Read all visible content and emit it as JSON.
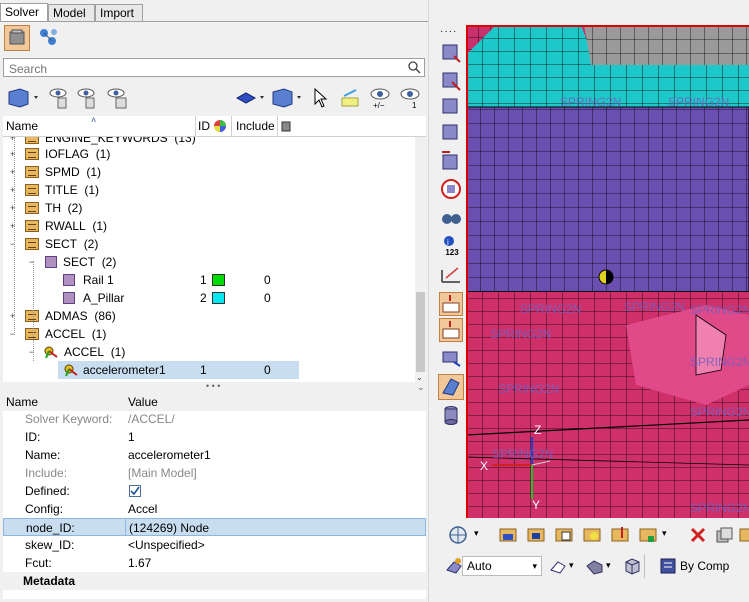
{
  "tabs": [
    {
      "label": "Solver",
      "close": "✕",
      "active": true
    },
    {
      "label": "Model",
      "active": false
    },
    {
      "label": "Import",
      "active": false
    }
  ],
  "search": {
    "placeholder": "Search"
  },
  "tree_header": {
    "name": "Name",
    "id": "ID",
    "include": "Include"
  },
  "tree_rows": [
    {
      "label": "ENGINE_KEYWORDS",
      "count": "(13)"
    },
    {
      "label": "IOFLAG",
      "count": "(1)"
    },
    {
      "label": "SPMD",
      "count": "(1)"
    },
    {
      "label": "TITLE",
      "count": "(1)"
    },
    {
      "label": "TH",
      "count": "(2)"
    },
    {
      "label": "RWALL",
      "count": "(1)"
    },
    {
      "label": "SECT",
      "count": "(2)"
    },
    {
      "label": "SECT",
      "count": "(2)"
    },
    {
      "label": "Rail 1",
      "id": "1",
      "include": "0",
      "color": "#00dd00"
    },
    {
      "label": "A_Pillar",
      "id": "2",
      "include": "0",
      "color": "#00e8f0"
    },
    {
      "label": "ADMAS",
      "count": "(86)"
    },
    {
      "label": "ACCEL",
      "count": "(1)"
    },
    {
      "label": "ACCEL",
      "count": "(1)"
    },
    {
      "label": "accelerometer1",
      "id": "1",
      "include": "0"
    }
  ],
  "props_header": {
    "name": "Name",
    "value": "Value"
  },
  "props": [
    {
      "k": "Solver Keyword:",
      "v": "/ACCEL/",
      "gray": true
    },
    {
      "k": "ID:",
      "v": "1"
    },
    {
      "k": "Name:",
      "v": "accelerometer1"
    },
    {
      "k": "Include:",
      "v": "[Main Model]",
      "gray": true
    },
    {
      "k": "Defined:",
      "v": ""
    },
    {
      "k": "Config:",
      "v": "Accel"
    },
    {
      "k": "node_ID:",
      "v": "(124269) Node"
    },
    {
      "k": "skew_ID:",
      "v": "<Unspecified>"
    },
    {
      "k": "Fcut:",
      "v": "1.67"
    }
  ],
  "metadata_label": "Metadata",
  "viewport": {
    "labels": [
      "SPRING2N",
      "SPRING2N",
      "SPRING2N",
      "SPRING2N",
      "SPRING2N",
      "SPRING2N",
      "SPRING2N",
      "SPRING2N",
      "SPRING2N",
      "SPRING2N",
      "SPRING2N"
    ],
    "axis_z": "Z",
    "axis_x": "X",
    "axis_y": "Y"
  },
  "vtool_labels": {
    "id_icon": "123"
  },
  "bottom_toolbar": {
    "auto_label": "Auto",
    "bycomp_label": "By Comp"
  },
  "colors": {
    "teal": "#1fc8c8",
    "purple": "#6a4fb0",
    "magenta": "#d0306a",
    "selection": "#c8def0"
  }
}
